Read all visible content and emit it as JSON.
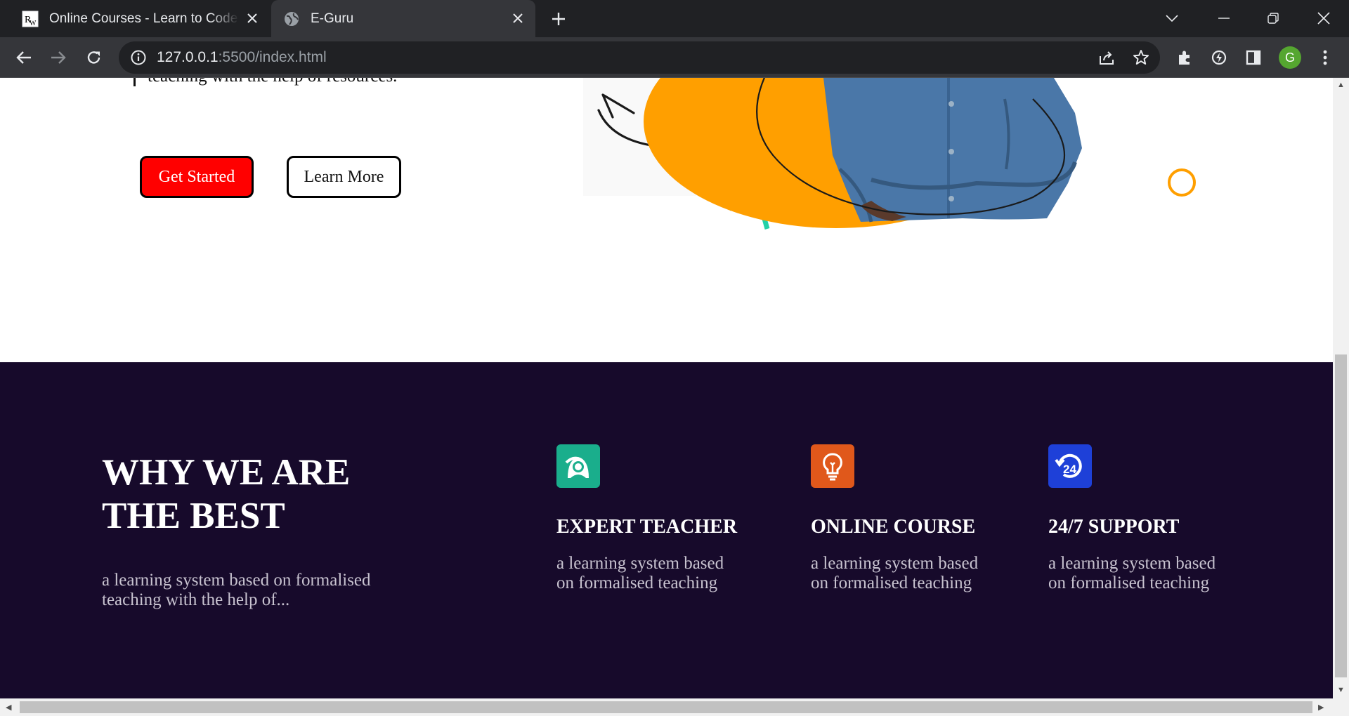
{
  "browser": {
    "tabs": [
      {
        "title": "Online Courses - Learn to Code Anywhere",
        "favicon": "site-logo-icon",
        "active": false
      },
      {
        "title": "E-Guru",
        "favicon": "globe-icon",
        "active": true
      }
    ],
    "url_host": "127.0.0.1",
    "url_path": ":5500/index.html",
    "profile_initial": "G"
  },
  "hero": {
    "partial_text": "teaching with the help of resources.",
    "get_started": "Get Started",
    "learn_more": "Learn More"
  },
  "why": {
    "title": "WHY WE ARE THE BEST",
    "description": "a learning system based on formalised teaching with the help of...",
    "features": [
      {
        "title": "EXPERT TEACHER",
        "description": "a learning system based on formalised teaching",
        "icon": "teacher-icon",
        "color": "#1aae8c"
      },
      {
        "title": "ONLINE COURSE",
        "description": "a learning system based on formalised teaching",
        "icon": "lightbulb-icon",
        "color": "#e0581b"
      },
      {
        "title": "24/7 SUPPORT",
        "description": "a learning system based on formalised teaching",
        "icon": "support-24-icon",
        "color": "#1e40d8"
      }
    ]
  },
  "colors": {
    "why_bg": "#170a2b",
    "accent_red": "#ff0000",
    "orange": "#ff9f00",
    "teal": "#23d1a8"
  }
}
